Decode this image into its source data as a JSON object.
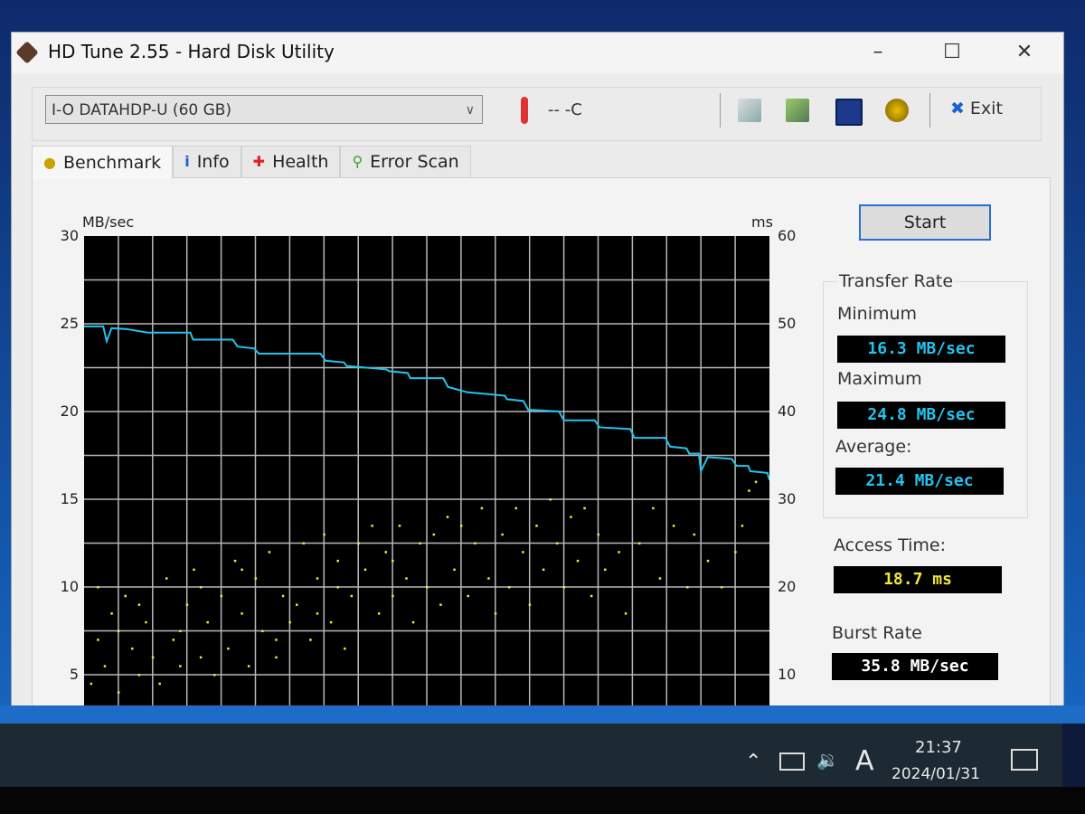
{
  "window": {
    "title": "HD Tune 2.55 - Hard Disk Utility",
    "minimize": "–",
    "maximize": "☐",
    "close": "✕"
  },
  "toolbar": {
    "drive": "I-O DATAHDP-U (60 GB)",
    "temperature": "-- -C",
    "exit_label": "Exit",
    "icons": [
      "copy-text-icon",
      "copy-screenshot-icon",
      "save-icon",
      "options-icon"
    ]
  },
  "tabs": [
    {
      "label": "Benchmark",
      "icon": "bulb-icon",
      "active": true
    },
    {
      "label": "Info",
      "icon": "info-icon",
      "active": false
    },
    {
      "label": "Health",
      "icon": "health-cross-icon",
      "active": false
    },
    {
      "label": "Error Scan",
      "icon": "magnifier-icon",
      "active": false
    }
  ],
  "benchmark": {
    "start_label": "Start",
    "transfer_rate_label": "Transfer Rate",
    "minimum_label": "Minimum",
    "minimum_value": "16.3 MB/sec",
    "maximum_label": "Maximum",
    "maximum_value": "24.8 MB/sec",
    "average_label": "Average:",
    "average_value": "21.4 MB/sec",
    "access_time_label": "Access Time:",
    "access_time_value": "18.7 ms",
    "burst_rate_label": "Burst Rate",
    "burst_rate_value": "35.8 MB/sec"
  },
  "colors": {
    "transfer": "#22c4ee",
    "access": "#f5e63a",
    "burst": "#ffffff",
    "plot_bg": "#000000",
    "grid": "#b8b8b8"
  },
  "chart_data": {
    "type": "line",
    "ylabel": "MB/sec",
    "y2label": "ms",
    "ylim": [
      0,
      30
    ],
    "y2lim": [
      0,
      60
    ],
    "yticks": [
      "30",
      "25",
      "20",
      "15",
      "10",
      "5"
    ],
    "y2ticks": [
      "60",
      "50",
      "40",
      "30",
      "20",
      "10"
    ],
    "grid": true,
    "series": [
      {
        "kind": "line",
        "axis": "left",
        "points": [
          [
            0,
            24.85
          ],
          [
            2.8,
            24.85
          ],
          [
            3.3,
            24.0
          ],
          [
            4,
            24.75
          ],
          [
            6.2,
            24.7
          ],
          [
            9.3,
            24.5
          ],
          [
            15.5,
            24.5
          ],
          [
            15.9,
            24.1
          ],
          [
            21.7,
            24.1
          ],
          [
            22.4,
            23.7
          ],
          [
            24.8,
            23.6
          ],
          [
            25.5,
            23.3
          ],
          [
            34.5,
            23.3
          ],
          [
            35.2,
            22.9
          ],
          [
            37.9,
            22.8
          ],
          [
            38.3,
            22.6
          ],
          [
            44.1,
            22.4
          ],
          [
            44.5,
            22.3
          ],
          [
            47.2,
            22.2
          ],
          [
            47.6,
            21.9
          ],
          [
            52.4,
            21.9
          ],
          [
            53.1,
            21.4
          ],
          [
            55.9,
            21.1
          ],
          [
            61.4,
            20.9
          ],
          [
            61.7,
            20.7
          ],
          [
            64.1,
            20.6
          ],
          [
            64.8,
            20.1
          ],
          [
            69.3,
            20.0
          ],
          [
            70,
            19.5
          ],
          [
            74.5,
            19.5
          ],
          [
            75.2,
            19.1
          ],
          [
            79.7,
            19.0
          ],
          [
            80.3,
            18.5
          ],
          [
            84.8,
            18.5
          ],
          [
            85.5,
            18.0
          ],
          [
            87.9,
            17.9
          ],
          [
            88.3,
            17.6
          ],
          [
            89.7,
            17.6
          ],
          [
            90,
            16.6
          ],
          [
            91,
            17.4
          ],
          [
            94.5,
            17.3
          ],
          [
            95.2,
            16.9
          ],
          [
            96.9,
            16.9
          ],
          [
            97.2,
            16.6
          ],
          [
            99.7,
            16.5
          ],
          [
            100,
            16.1
          ]
        ]
      },
      {
        "kind": "scatter",
        "axis": "right",
        "points": [
          [
            1,
            9
          ],
          [
            2,
            14
          ],
          [
            3,
            11
          ],
          [
            4,
            17
          ],
          [
            5,
            8
          ],
          [
            6,
            19
          ],
          [
            7,
            13
          ],
          [
            8,
            10
          ],
          [
            9,
            16
          ],
          [
            10,
            12
          ],
          [
            2,
            20
          ],
          [
            5,
            15
          ],
          [
            8,
            18
          ],
          [
            11,
            9
          ],
          [
            12,
            21
          ],
          [
            13,
            14
          ],
          [
            14,
            11
          ],
          [
            15,
            18
          ],
          [
            16,
            22
          ],
          [
            17,
            12
          ],
          [
            18,
            16
          ],
          [
            19,
            10
          ],
          [
            20,
            19
          ],
          [
            14,
            15
          ],
          [
            17,
            20
          ],
          [
            21,
            13
          ],
          [
            22,
            23
          ],
          [
            23,
            17
          ],
          [
            24,
            11
          ],
          [
            25,
            21
          ],
          [
            26,
            15
          ],
          [
            27,
            24
          ],
          [
            28,
            12
          ],
          [
            29,
            19
          ],
          [
            30,
            16
          ],
          [
            23,
            22
          ],
          [
            28,
            14
          ],
          [
            31,
            18
          ],
          [
            32,
            25
          ],
          [
            33,
            14
          ],
          [
            34,
            21
          ],
          [
            35,
            26
          ],
          [
            36,
            16
          ],
          [
            37,
            23
          ],
          [
            38,
            13
          ],
          [
            39,
            19
          ],
          [
            40,
            25
          ],
          [
            34,
            17
          ],
          [
            37,
            20
          ],
          [
            41,
            22
          ],
          [
            42,
            27
          ],
          [
            43,
            17
          ],
          [
            44,
            24
          ],
          [
            45,
            19
          ],
          [
            46,
            27
          ],
          [
            47,
            21
          ],
          [
            48,
            16
          ],
          [
            49,
            25
          ],
          [
            50,
            20
          ],
          [
            45,
            23
          ],
          [
            51,
            26
          ],
          [
            52,
            18
          ],
          [
            53,
            28
          ],
          [
            54,
            22
          ],
          [
            55,
            27
          ],
          [
            56,
            19
          ],
          [
            57,
            25
          ],
          [
            58,
            29
          ],
          [
            59,
            21
          ],
          [
            60,
            17
          ],
          [
            61,
            26
          ],
          [
            62,
            20
          ],
          [
            63,
            29
          ],
          [
            64,
            24
          ],
          [
            65,
            18
          ],
          [
            66,
            27
          ],
          [
            67,
            22
          ],
          [
            68,
            30
          ],
          [
            69,
            25
          ],
          [
            70,
            20
          ],
          [
            71,
            28
          ],
          [
            72,
            23
          ],
          [
            73,
            29
          ],
          [
            74,
            19
          ],
          [
            75,
            26
          ],
          [
            76,
            22
          ],
          [
            78,
            24
          ],
          [
            79,
            17
          ],
          [
            81,
            25
          ],
          [
            83,
            29
          ],
          [
            84,
            21
          ],
          [
            86,
            27
          ],
          [
            88,
            20
          ],
          [
            89,
            26
          ],
          [
            91,
            23
          ],
          [
            93,
            20
          ],
          [
            95,
            24
          ],
          [
            97,
            31
          ],
          [
            98,
            32
          ],
          [
            96,
            27
          ]
        ]
      }
    ]
  },
  "taskbar": {
    "time": "21:37",
    "date": "2024/01/31",
    "ime": "A",
    "icons": [
      "chevron-up-icon",
      "network-icon",
      "volume-icon",
      "notification-icon"
    ]
  }
}
